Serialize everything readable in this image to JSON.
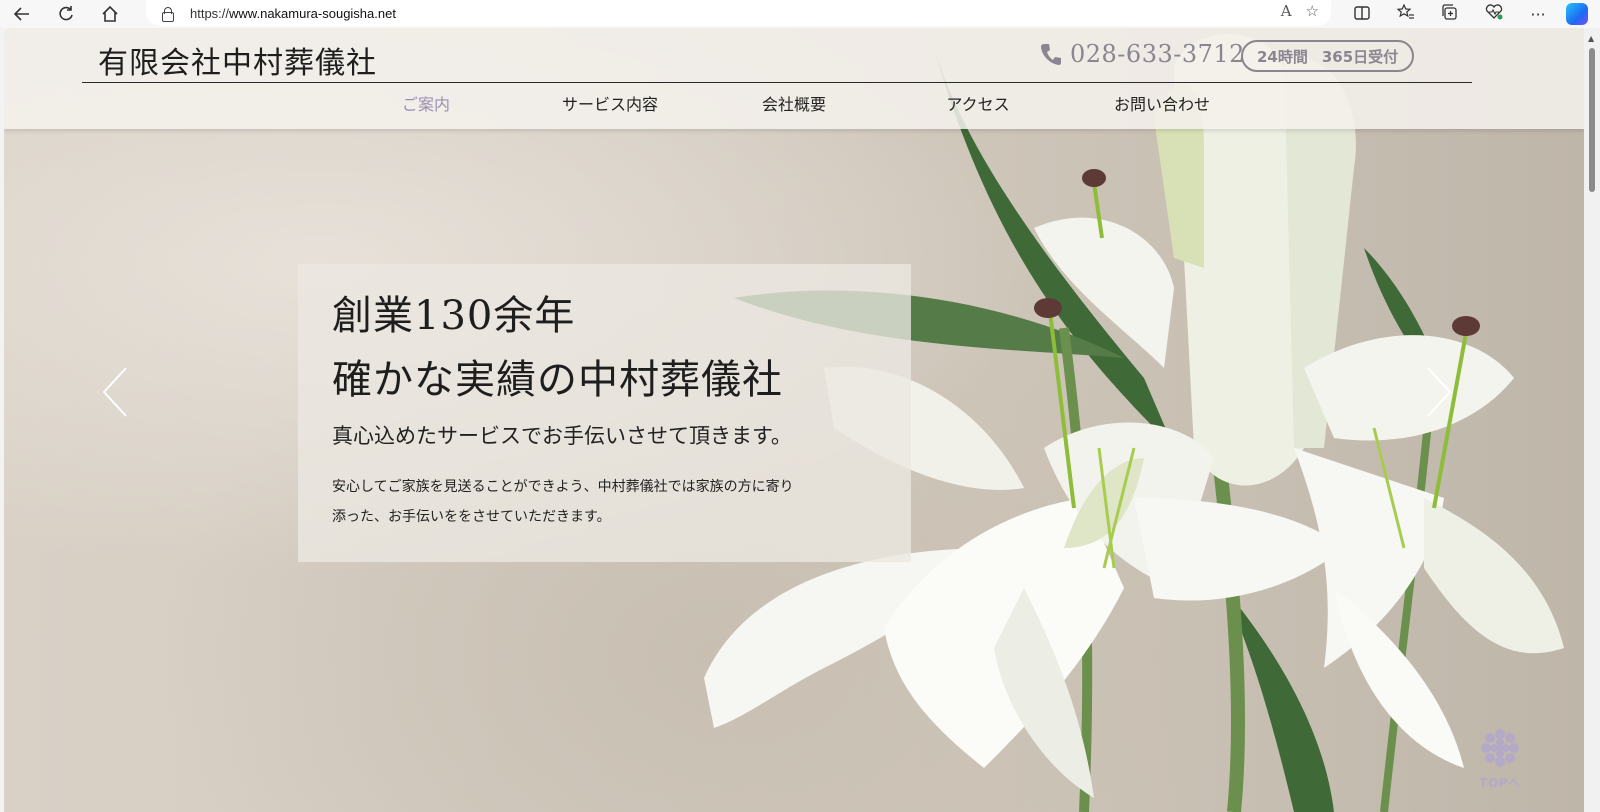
{
  "browser": {
    "url_prefix": "https://",
    "url_host": "www.nakamura-sougisha.net",
    "read_aloud_label": "A"
  },
  "header": {
    "logo": "有限会社中村葬儀社",
    "phone": "028-633-3712",
    "badge_hours": "24時間",
    "badge_days": "365日受付",
    "nav": [
      {
        "label": "ご案内"
      },
      {
        "label": "サービス内容"
      },
      {
        "label": "会社概要"
      },
      {
        "label": "アクセス"
      },
      {
        "label": "お問い合わせ"
      }
    ]
  },
  "hero": {
    "line1": "創業130余年",
    "line2": "確かな実績の中村葬儀社",
    "subtitle": "真心込めたサービスでお手伝いさせて頂きます。",
    "desc_line1": "安心してご家族を見送ることができよう、中村葬儀社では家族の方に寄り",
    "desc_line2": "添った、お手伝いををさせていただきます。"
  },
  "top_button": {
    "label": "TOPへ"
  },
  "colors": {
    "accent": "#9a8fb0",
    "phone": "#8a8590",
    "text": "#1e1e1e"
  }
}
